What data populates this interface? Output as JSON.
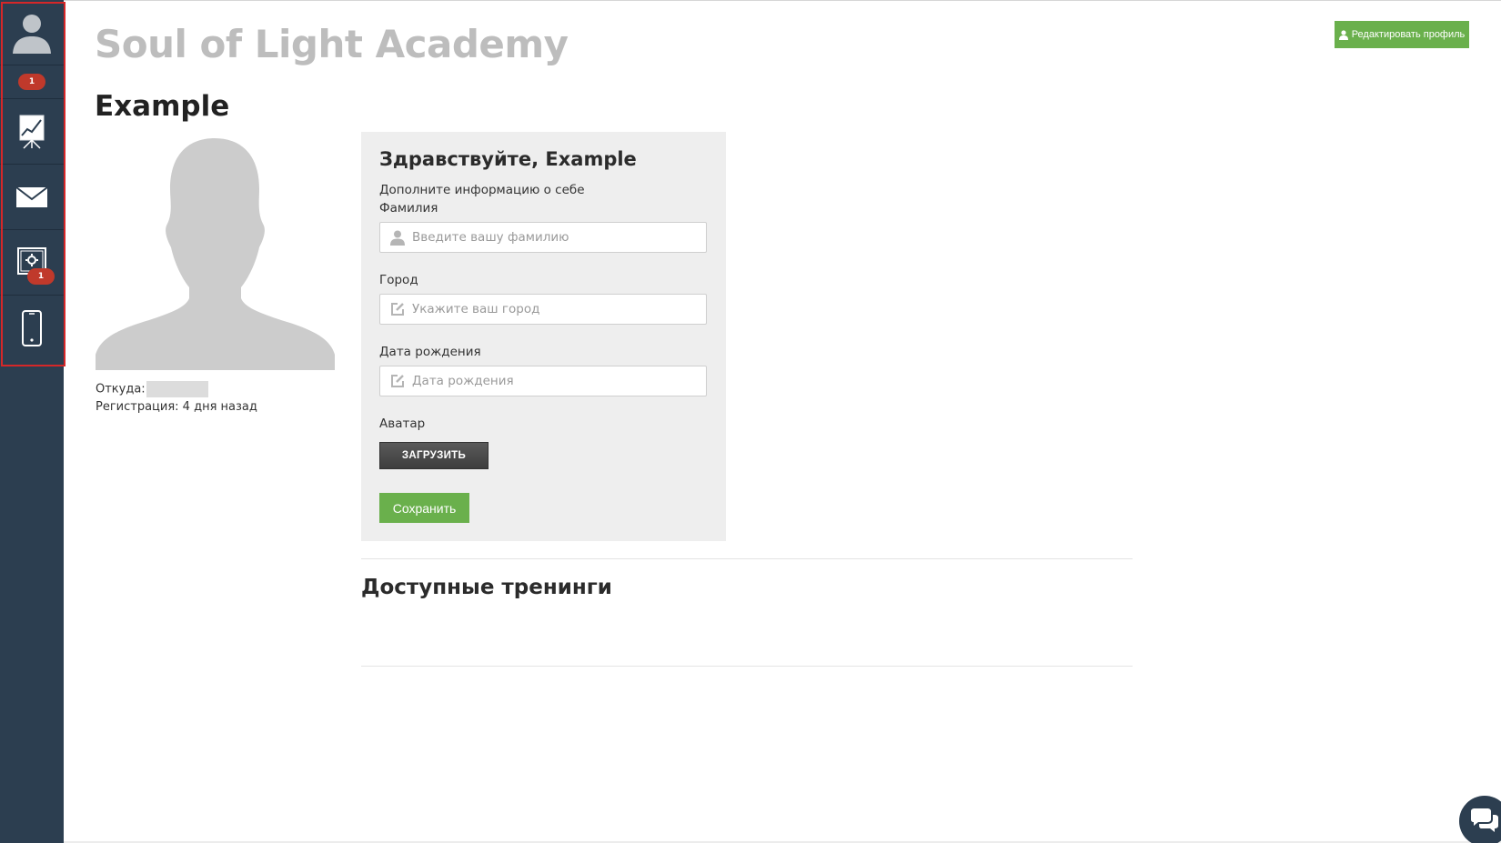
{
  "app": {
    "title": "Soul of Light Academy"
  },
  "header": {
    "edit_profile_label": "Редактировать профиль"
  },
  "sidebar": {
    "items": [
      {
        "icon": "user-icon",
        "badge": "1"
      },
      {
        "icon": "chart-icon"
      },
      {
        "icon": "mail-icon"
      },
      {
        "icon": "settings-monitor-icon",
        "badge": "1"
      },
      {
        "icon": "mobile-icon"
      }
    ]
  },
  "profile": {
    "name": "Example",
    "from_label": "Откуда:",
    "registration": "Регистрация: 4 дня назад"
  },
  "form": {
    "greeting": "Здравствуйте, Example",
    "subtitle": "Дополните информацию о себе",
    "surname_label": "Фамилия",
    "surname_placeholder": "Введите вашу фамилию",
    "city_label": "Город",
    "city_placeholder": "Укажите ваш город",
    "birthdate_label": "Дата рождения",
    "birthdate_placeholder": "Дата рождения",
    "avatar_label": "Аватар",
    "upload_label": "ЗАГРУЗИТЬ",
    "save_label": "Сохранить"
  },
  "trainings": {
    "title": "Доступные тренинги"
  },
  "colors": {
    "sidebar": "#2c3e50",
    "accent_green": "#6ab04c",
    "badge_red": "#c0392b",
    "highlight_border": "#d62728"
  }
}
